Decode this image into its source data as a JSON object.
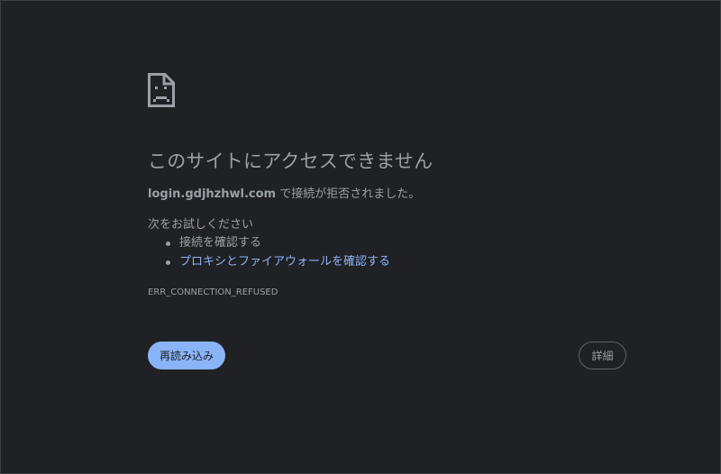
{
  "error_page": {
    "icon": "sad-page-icon",
    "title": "このサイトにアクセスできません",
    "host": "login.gdjhzhwl.com",
    "message_suffix": " で接続が拒否されました。",
    "try_heading": "次をお試しください",
    "suggestions": [
      {
        "label": "接続を確認する",
        "is_link": false
      },
      {
        "label": "プロキシとファイアウォールを確認する",
        "is_link": true
      }
    ],
    "error_code": "ERR_CONNECTION_REFUSED",
    "reload_label": "再読み込み",
    "details_label": "詳細"
  },
  "colors": {
    "background": "#202124",
    "text": "#9aa0a6",
    "link": "#8ab4f8",
    "primary_button": "#8ab4f8",
    "border": "#5f6368"
  }
}
